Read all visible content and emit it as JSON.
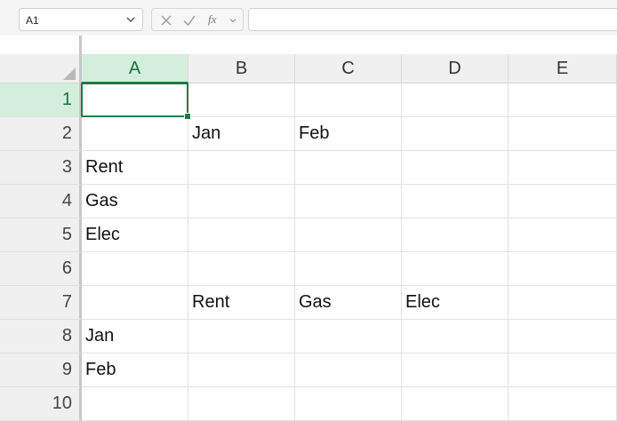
{
  "formula_bar": {
    "name_box": "A1",
    "fx_label": "fx",
    "formula_value": ""
  },
  "sheet": {
    "columns": [
      "A",
      "B",
      "C",
      "D",
      "E"
    ],
    "rows": [
      "1",
      "2",
      "3",
      "4",
      "5",
      "6",
      "7",
      "8",
      "9",
      "10"
    ],
    "cells": [
      [
        "",
        "",
        "",
        "",
        ""
      ],
      [
        "",
        "Jan",
        "Feb",
        "",
        ""
      ],
      [
        "Rent",
        "",
        "",
        "",
        ""
      ],
      [
        "Gas",
        "",
        "",
        "",
        ""
      ],
      [
        "Elec",
        "",
        "",
        "",
        ""
      ],
      [
        "",
        "",
        "",
        "",
        ""
      ],
      [
        "",
        "Rent",
        "Gas",
        "Elec",
        ""
      ],
      [
        "Jan",
        "",
        "",
        "",
        ""
      ],
      [
        "Feb",
        "",
        "",
        "",
        ""
      ],
      [
        "",
        "",
        "",
        "",
        ""
      ]
    ],
    "active_cell": "A1",
    "selection_color": "#1f7a45",
    "header_highlight_color": "#d3efdc"
  }
}
